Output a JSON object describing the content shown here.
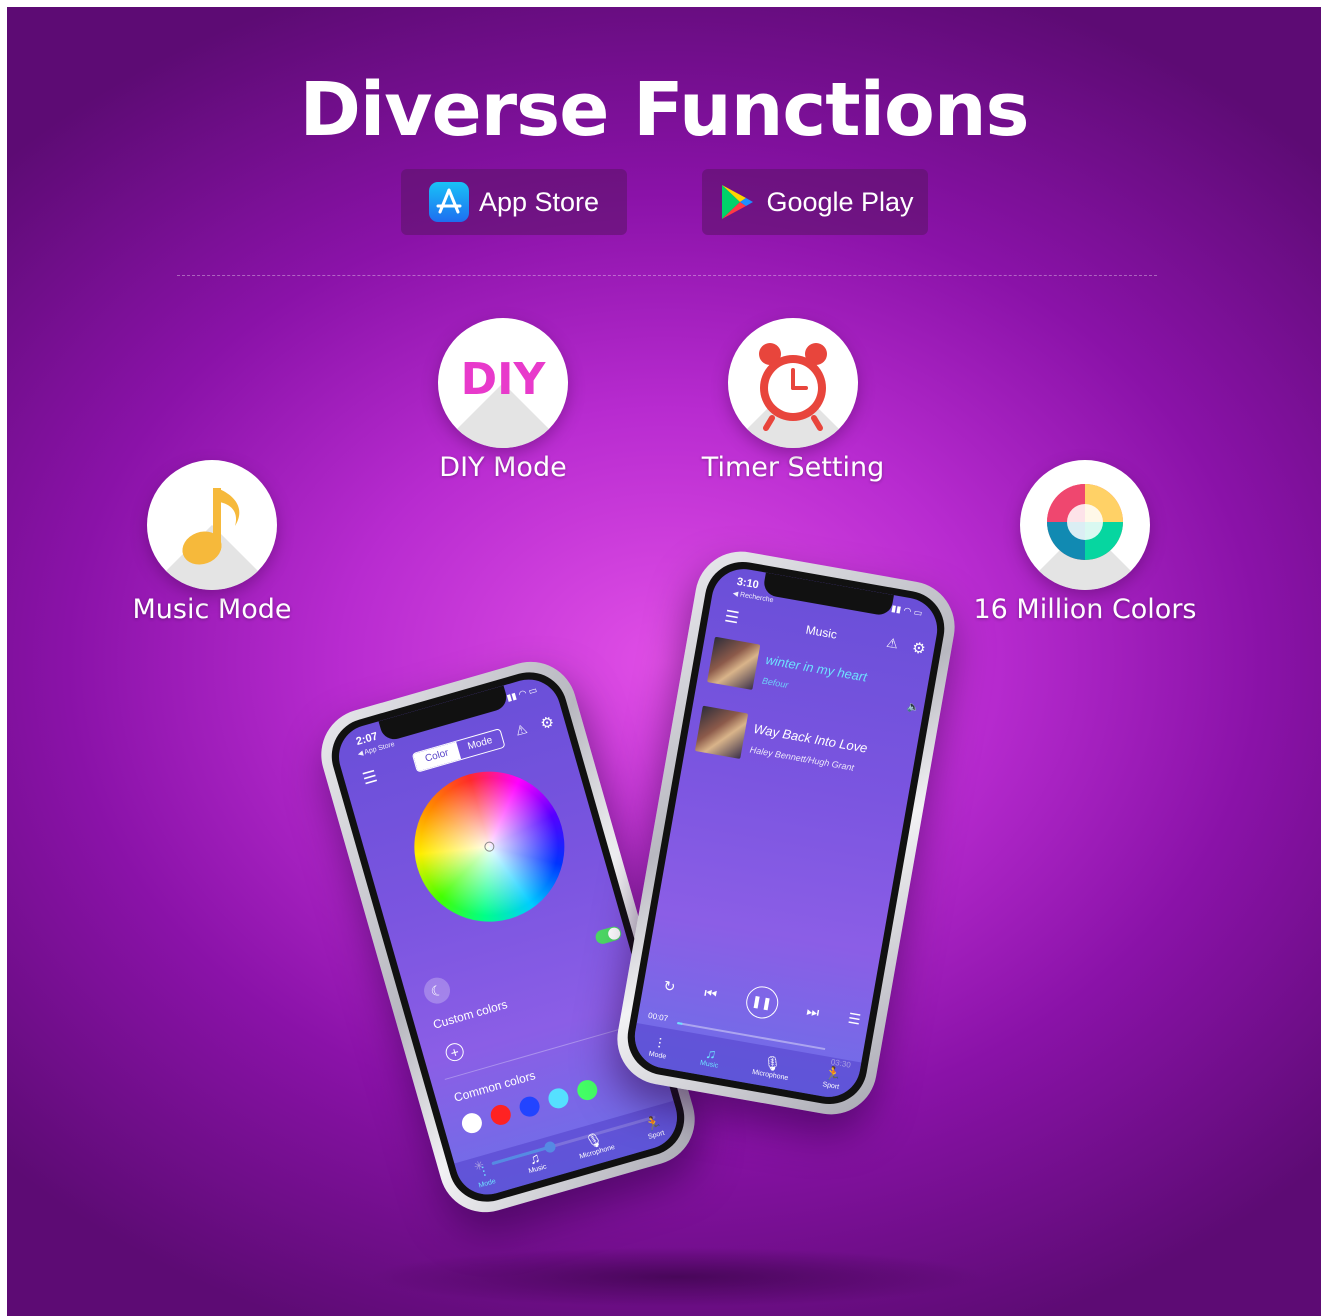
{
  "title": "Diverse Functions",
  "stores": {
    "app_store": "App Store",
    "google_play": "Google Play"
  },
  "features": [
    {
      "label": "DIY Mode",
      "icon": "diy-icon",
      "icon_text": "DIY"
    },
    {
      "label": "Timer Setting",
      "icon": "alarm-clock-icon"
    },
    {
      "label": "Music Mode",
      "icon": "music-note-icon"
    },
    {
      "label": "16 Million Colors",
      "icon": "color-wheel-icon"
    }
  ],
  "phone_left": {
    "time": "2:07",
    "back_link": "◀ App Store",
    "segments": [
      "Color",
      "Mode"
    ],
    "custom_colors_label": "Custom colors",
    "common_colors_label": "Common colors",
    "swatch_colors": [
      "#ffffff",
      "#ff2222",
      "#2244ff",
      "#55e0ff",
      "#44ff66"
    ],
    "brightness": 0.35,
    "tabs": [
      "Mode",
      "Music",
      "Microphone",
      "Sport"
    ]
  },
  "phone_right": {
    "time": "3:10",
    "back_link": "◀ Recherche",
    "header_title": "Music",
    "songs": [
      {
        "title": "winter in my heart",
        "artist": "Befour"
      },
      {
        "title": "Way Back Into Love",
        "artist": "Haley Bennett/Hugh Grant"
      }
    ],
    "time_elapsed": "00:07",
    "time_total": "03:30",
    "progress": 0.03,
    "tabs": [
      "Mode",
      "Music",
      "Microphone",
      "Sport"
    ]
  },
  "colors": {
    "accent": "#e83acb",
    "timer_red": "#e8453c",
    "music_yellow": "#f6b93b",
    "active_tab": "#6ee0ff"
  }
}
